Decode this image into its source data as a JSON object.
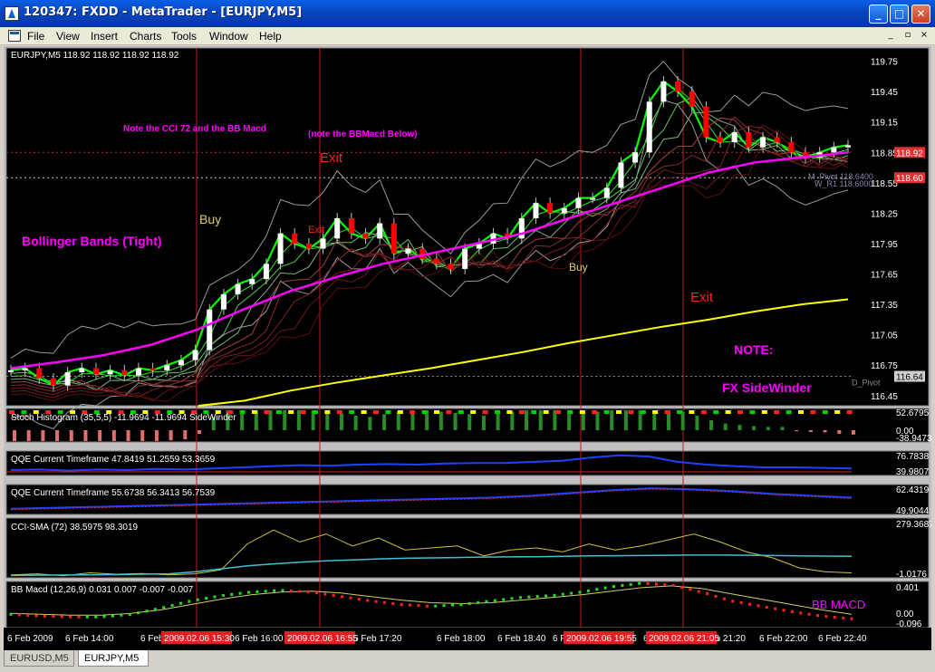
{
  "window": {
    "title": "120347: FXDD - MetaTrader - [EURJPY,M5]",
    "buttons": {
      "minimize": "_",
      "maximize": "□",
      "close": "✕"
    }
  },
  "menu": {
    "items": [
      "File",
      "View",
      "Insert",
      "Charts",
      "Tools",
      "Window",
      "Help"
    ],
    "mdi": {
      "minimize": "_",
      "restore": "▫",
      "close": "×"
    }
  },
  "tabs": [
    {
      "label": "EURUSD,M5",
      "active": false
    },
    {
      "label": "EURJPY,M5",
      "active": true
    }
  ],
  "colors": {
    "background": "#000000",
    "candle_up": "#ffffff",
    "candle_down": "#ff0000",
    "ma_fast": "#00ff00",
    "ma_slow": "#8b1a1a",
    "trend": "#ff00ff",
    "long_ma": "#ffff00",
    "annotation": "#ff00ff",
    "signal": "#ff2020",
    "buy": "#e0d060",
    "vline": "#b02020"
  },
  "chart_data": [
    {
      "type": "candlestick",
      "pane": "main",
      "title": "EURJPY,M5  118.92 118.92 118.92 118.92",
      "y_ticks": [
        "119.75",
        "119.45",
        "119.15",
        "118.85",
        "118.55",
        "118.25",
        "117.95",
        "117.65",
        "117.35",
        "117.05",
        "116.75",
        "116.45"
      ],
      "ylim": [
        116.35,
        119.88
      ],
      "current_price": "118.92",
      "price_tags": [
        "118.60",
        "116.64"
      ],
      "pivot_labels": [
        "M_Pivot 118.6400",
        "W_R1 118.6000",
        "D_Pivot"
      ],
      "annotations": [
        "Note the CCI 72 and the BB Macd",
        "(note the BBMacd Below)",
        "Bollinger Bands (Tight)",
        "Buy",
        "Exit",
        "Exit",
        "Exit",
        "Buy",
        "NOTE:",
        "FX SideWinder"
      ],
      "close_path": [
        116.7,
        116.72,
        116.62,
        116.55,
        116.68,
        116.72,
        116.66,
        116.7,
        116.65,
        116.72,
        116.7,
        116.75,
        116.8,
        116.9,
        117.3,
        117.45,
        117.55,
        117.6,
        117.75,
        118.05,
        117.95,
        117.9,
        118.0,
        118.2,
        118.05,
        118.0,
        118.15,
        117.85,
        117.9,
        117.8,
        117.75,
        117.7,
        117.9,
        117.95,
        118.05,
        118.0,
        118.2,
        118.35,
        118.25,
        118.3,
        118.4,
        118.4,
        118.5,
        118.75,
        118.85,
        119.35,
        119.55,
        119.45,
        119.3,
        119.0,
        118.95,
        119.05,
        118.9,
        119.0,
        118.95,
        118.85,
        118.8,
        118.85,
        118.9,
        118.92
      ],
      "long_ma_path": [
        116.35,
        116.4,
        116.5,
        116.58,
        116.65,
        116.72,
        116.8,
        116.88,
        116.97,
        117.05,
        117.13,
        117.2,
        117.28,
        117.35,
        117.4
      ],
      "trend_path": [
        116.72,
        116.78,
        116.85,
        116.95,
        117.1,
        117.3,
        117.48,
        117.62,
        117.75,
        117.85,
        117.95,
        118.05,
        118.2,
        118.35,
        118.5,
        118.65,
        118.75,
        118.8,
        118.85
      ]
    },
    {
      "type": "histogram",
      "pane": "stoch",
      "title": "Stoch Histogram (35,5,5) -11.9694 -11.9694  SideWinder",
      "y_ticks": [
        "52.6795",
        "0.00",
        "-38.9473"
      ],
      "values": [
        -30,
        -30,
        -30,
        -30,
        -30,
        -30,
        -30,
        -30,
        -30,
        -30,
        -30,
        -28,
        -25,
        -10,
        20,
        30,
        30,
        30,
        30,
        30,
        30,
        30,
        28,
        25,
        22,
        20,
        24,
        28,
        30,
        30,
        28,
        26,
        24,
        22,
        25,
        28,
        30,
        30,
        30,
        30,
        28,
        28,
        30,
        30,
        30,
        30,
        30,
        28,
        22,
        15,
        10,
        8,
        6,
        5,
        5,
        -3,
        -5,
        -6,
        -10,
        -12
      ]
    },
    {
      "type": "line",
      "pane": "qqe1",
      "title": "QQE Current Timeframe 47.8419 51.2559 53.3659",
      "y_ticks": [
        "76.7838",
        "39.9807"
      ],
      "values": [
        45,
        46,
        44,
        46,
        45,
        47,
        46,
        48,
        50,
        52,
        54,
        53,
        55,
        56,
        55,
        57,
        58,
        58,
        60,
        62,
        68,
        72,
        70,
        60,
        55,
        52,
        50,
        50,
        49,
        48
      ]
    },
    {
      "type": "line",
      "pane": "qqe2",
      "title": "QQE Current Timeframe 55.6738 56.3413 56.7539",
      "y_ticks": [
        "62.4319",
        "49.9044"
      ],
      "values": [
        51,
        51.5,
        52,
        52.5,
        53,
        53.5,
        54,
        54.5,
        55,
        55.5,
        56,
        56.5,
        57,
        58,
        59.5,
        61,
        62,
        61.5,
        60.5,
        59,
        58,
        57
      ]
    },
    {
      "type": "line",
      "pane": "cci",
      "title": "CCI-SMA (72)  38.5975 98.3019",
      "y_ticks": [
        "279.3687",
        "-1.0176"
      ],
      "series": [
        {
          "values": [
            5,
            10,
            0,
            15,
            8,
            12,
            5,
            10,
            30,
            160,
            230,
            170,
            210,
            150,
            190,
            130,
            140,
            150,
            100,
            130,
            140,
            120,
            160,
            130,
            150,
            180,
            210,
            170,
            120,
            90,
            40,
            20,
            15
          ]
        },
        {
          "values": [
            2,
            3,
            4,
            5,
            6,
            8,
            10,
            20,
            35,
            50,
            60,
            68,
            75,
            80,
            85,
            88,
            90,
            92,
            94,
            95,
            96,
            98,
            100,
            101,
            102,
            103,
            104,
            104,
            103,
            102,
            100,
            99,
            98
          ]
        }
      ]
    },
    {
      "type": "line",
      "pane": "bbmacd",
      "title": "BB Macd (12,26,9) 0.031 0.007 -0.007 -0.007",
      "label": "BB MACD",
      "y_ticks": [
        "0.401",
        "0.00",
        "-0.096"
      ],
      "series": [
        {
          "values": [
            0.05,
            0.03,
            0.02,
            0.02,
            0.05,
            0.12,
            0.2,
            0.26,
            0.3,
            0.32,
            0.3,
            0.25,
            0.2,
            0.16,
            0.14,
            0.16,
            0.2,
            0.24,
            0.26,
            0.3,
            0.36,
            0.4,
            0.38,
            0.3,
            0.2,
            0.14,
            0.08,
            0.03,
            0.0
          ]
        },
        {
          "values": [
            0.06,
            0.05,
            0.04,
            0.04,
            0.06,
            0.1,
            0.16,
            0.22,
            0.27,
            0.3,
            0.31,
            0.29,
            0.25,
            0.21,
            0.18,
            0.17,
            0.18,
            0.21,
            0.24,
            0.27,
            0.31,
            0.35,
            0.37,
            0.34,
            0.28,
            0.22,
            0.16,
            0.1,
            0.05
          ]
        }
      ]
    }
  ],
  "x_axis": {
    "ticks": [
      "6 Feb 2009",
      "6 Feb 14:00",
      "6 Feb 14:4",
      "6 Feb 16:00",
      "6 Feb 17:20",
      "6 Feb 18:00",
      "6 Feb 18:40",
      "6 Fe",
      "0:00",
      "6 Fe",
      "eb 21:20",
      "6 Feb 22:00",
      "6 Feb 22:40"
    ],
    "markers": [
      "2009.02.06 15:30",
      "2009.02.06 16:55",
      "2009.02.06 19:55",
      "2009.02.06 21:05"
    ]
  }
}
